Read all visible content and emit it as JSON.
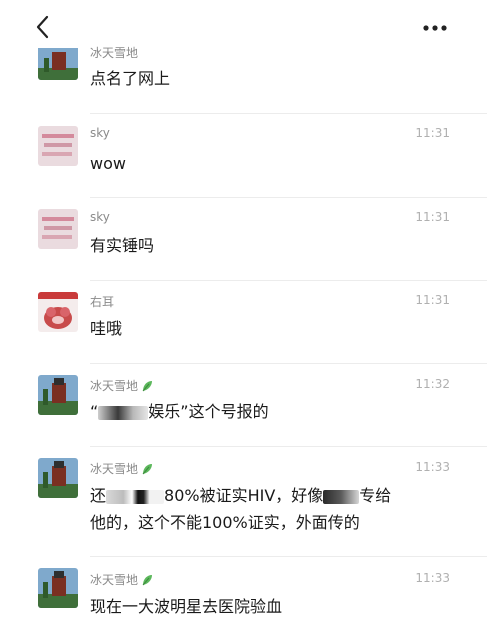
{
  "nav": {
    "back_icon": "back-chevron-icon",
    "more_icon": "more-dots-icon"
  },
  "messages": [
    {
      "sender": "冰天雪地",
      "time": "",
      "text": "点名了网上"
    },
    {
      "sender": "sky",
      "time": "11:31",
      "text": "wow"
    },
    {
      "sender": "sky",
      "time": "11:31",
      "text": "有实锤吗"
    },
    {
      "sender": "右耳",
      "time": "11:31",
      "text": "哇哦"
    },
    {
      "sender": "冰天雪地",
      "time": "11:32",
      "text_a": "“",
      "text_b": "娱乐”这个号报的"
    },
    {
      "sender": "冰天雪地",
      "time": "11:33",
      "line1_a": "还",
      "line1_b": "80%被证实HIV，好像",
      "line1_c": "专给",
      "line2": "他的，这个不能100%证实，外面传的"
    },
    {
      "sender": "冰天雪地",
      "time": "11:33",
      "text": "现在一大波明星去医院验血"
    }
  ],
  "colors": {
    "name": "#8a8a8a",
    "time": "#b0b0b0",
    "separator": "#ececec",
    "leaf": "#5cb85c"
  }
}
